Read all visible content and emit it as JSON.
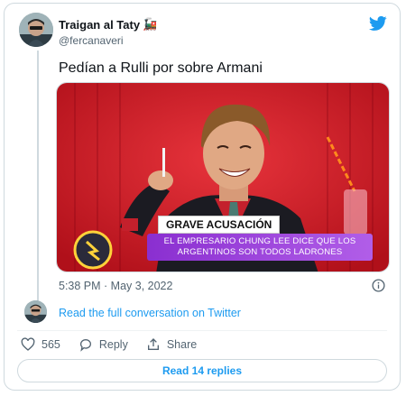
{
  "tweet": {
    "author_name": "Traigan al Taty",
    "author_emoji": "🚂",
    "handle": "@fercanaveri",
    "text": "Pedían a Rulli por sobre Armani",
    "timestamp": "5:38 PM · May 3, 2022"
  },
  "media": {
    "banner_title": "GRAVE ACUSACIÓN",
    "banner_text": "EL EMPRESARIO CHUNG LEE DICE QUE LOS ARGENTINOS SON TODOS LADRONES"
  },
  "conversation_link": "Read the full conversation on Twitter",
  "actions": {
    "like_count": "565",
    "reply_label": "Reply",
    "share_label": "Share"
  },
  "read_replies_label": "Read 14 replies",
  "colors": {
    "link_blue": "#1d9bf0",
    "border": "#cfd9de",
    "muted_text": "#536471",
    "media_red": "#d8202a"
  }
}
